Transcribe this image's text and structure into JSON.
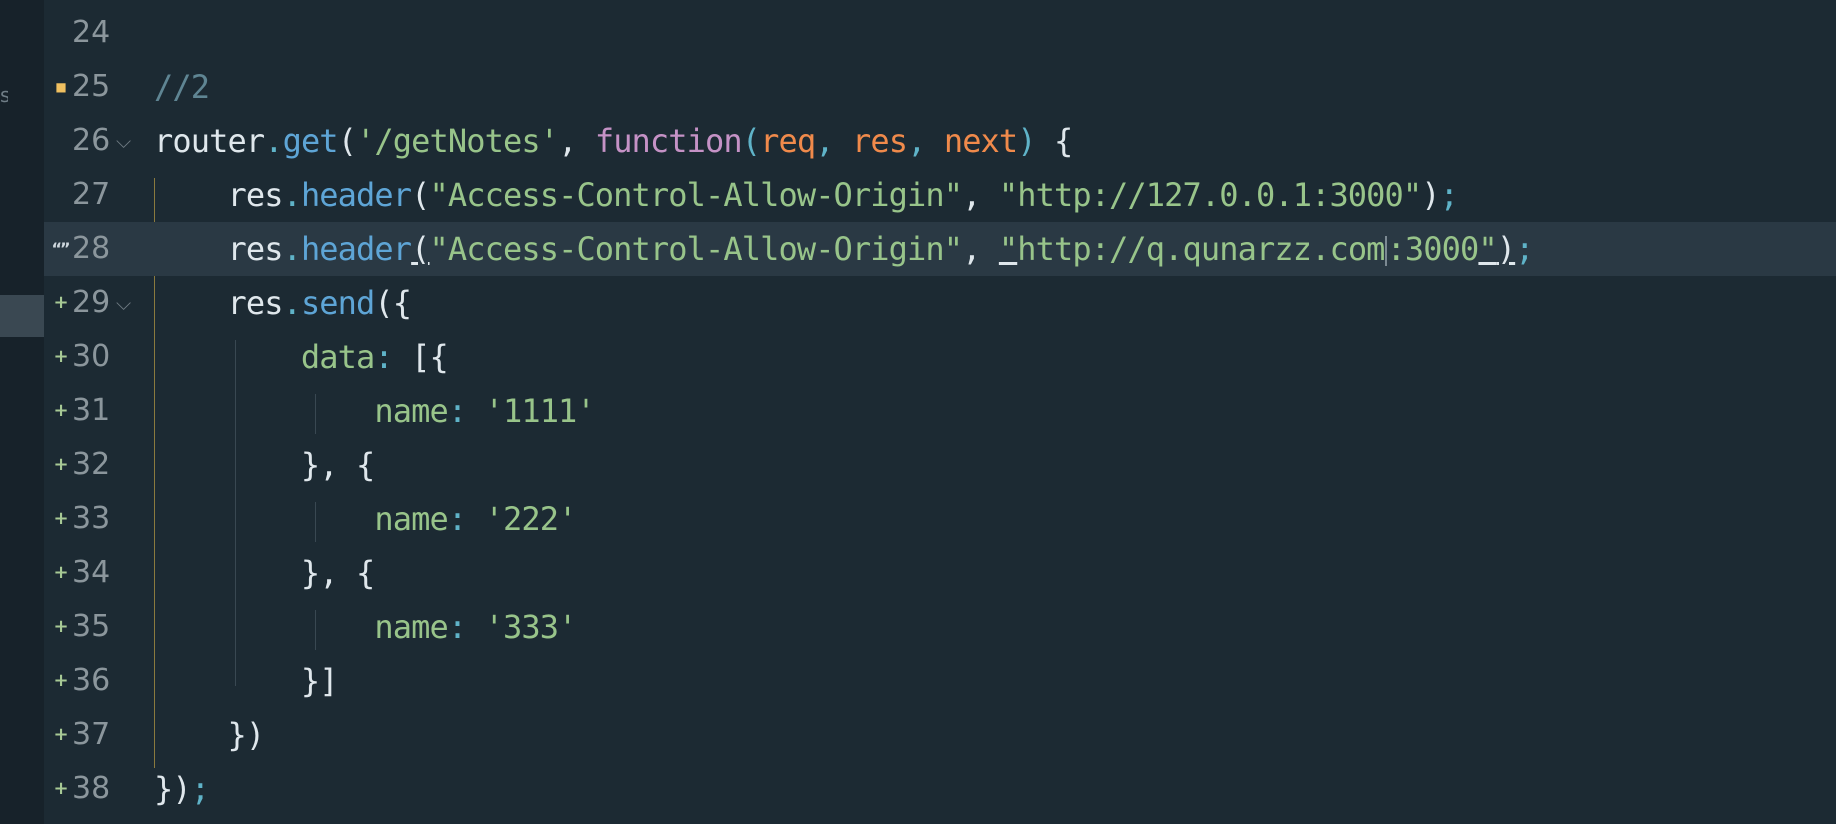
{
  "sidebar": {
    "fragment": "s"
  },
  "lines": [
    {
      "num": "24",
      "marker": "",
      "fold": false,
      "tokens": []
    },
    {
      "num": "25",
      "marker": "modified",
      "fold": false,
      "tokens": [
        {
          "t": "//2",
          "c": "comment"
        }
      ]
    },
    {
      "num": "26",
      "marker": "",
      "fold": true,
      "tokens": [
        {
          "t": "router",
          "c": "plain"
        },
        {
          "t": ".",
          "c": "punct"
        },
        {
          "t": "get",
          "c": "method"
        },
        {
          "t": "(",
          "c": "plain"
        },
        {
          "t": "'/getNotes'",
          "c": "string"
        },
        {
          "t": ", ",
          "c": "plain"
        },
        {
          "t": "function",
          "c": "keyword"
        },
        {
          "t": "(",
          "c": "punct"
        },
        {
          "t": "req",
          "c": "param"
        },
        {
          "t": ", ",
          "c": "punct"
        },
        {
          "t": "res",
          "c": "param"
        },
        {
          "t": ", ",
          "c": "punct"
        },
        {
          "t": "next",
          "c": "param"
        },
        {
          "t": ") ",
          "c": "punct"
        },
        {
          "t": "{",
          "c": "plain"
        }
      ]
    },
    {
      "num": "27",
      "marker": "",
      "fold": false,
      "tokens": [
        {
          "t": "    res",
          "c": "plain"
        },
        {
          "t": ".",
          "c": "punct"
        },
        {
          "t": "header",
          "c": "method"
        },
        {
          "t": "(",
          "c": "plain"
        },
        {
          "t": "\"Access-Control-Allow-Origin\"",
          "c": "string"
        },
        {
          "t": ", ",
          "c": "plain"
        },
        {
          "t": "\"http://127.0.0.1:3000\"",
          "c": "string"
        },
        {
          "t": ")",
          "c": "plain"
        },
        {
          "t": ";",
          "c": "punct"
        }
      ]
    },
    {
      "num": "28",
      "marker": "quote",
      "fold": false,
      "active": true,
      "tokens": [
        {
          "t": "    res",
          "c": "plain"
        },
        {
          "t": ".",
          "c": "punct"
        },
        {
          "t": "header",
          "c": "method"
        },
        {
          "t": "(",
          "c": "plain",
          "u": true
        },
        {
          "t": "\"Access-Control-Allow-Origin\"",
          "c": "string"
        },
        {
          "t": ", ",
          "c": "plain"
        },
        {
          "t": "\"",
          "c": "string",
          "u": true
        },
        {
          "t": "http://q.qunarzz.com",
          "c": "string"
        },
        {
          "t": "",
          "c": "cursor"
        },
        {
          "t": ":3000",
          "c": "string"
        },
        {
          "t": "\"",
          "c": "string",
          "u": true
        },
        {
          "t": ")",
          "c": "plain",
          "u": true
        },
        {
          "t": ";",
          "c": "punct"
        }
      ]
    },
    {
      "num": "29",
      "marker": "added",
      "fold": true,
      "tokens": [
        {
          "t": "    res",
          "c": "plain"
        },
        {
          "t": ".",
          "c": "punct"
        },
        {
          "t": "send",
          "c": "method"
        },
        {
          "t": "({",
          "c": "plain"
        }
      ]
    },
    {
      "num": "30",
      "marker": "added",
      "fold": false,
      "tokens": [
        {
          "t": "        data",
          "c": "prop"
        },
        {
          "t": ": ",
          "c": "punct"
        },
        {
          "t": "[{",
          "c": "plain"
        }
      ]
    },
    {
      "num": "31",
      "marker": "added",
      "fold": false,
      "tokens": [
        {
          "t": "            name",
          "c": "prop"
        },
        {
          "t": ": ",
          "c": "punct"
        },
        {
          "t": "'1111'",
          "c": "string"
        }
      ]
    },
    {
      "num": "32",
      "marker": "added",
      "fold": false,
      "tokens": [
        {
          "t": "        }, {",
          "c": "plain"
        }
      ]
    },
    {
      "num": "33",
      "marker": "added",
      "fold": false,
      "tokens": [
        {
          "t": "            name",
          "c": "prop"
        },
        {
          "t": ": ",
          "c": "punct"
        },
        {
          "t": "'222'",
          "c": "string"
        }
      ]
    },
    {
      "num": "34",
      "marker": "added",
      "fold": false,
      "tokens": [
        {
          "t": "        }, {",
          "c": "plain"
        }
      ]
    },
    {
      "num": "35",
      "marker": "added",
      "fold": false,
      "tokens": [
        {
          "t": "            name",
          "c": "prop"
        },
        {
          "t": ": ",
          "c": "punct"
        },
        {
          "t": "'333'",
          "c": "string"
        }
      ]
    },
    {
      "num": "36",
      "marker": "added",
      "fold": false,
      "tokens": [
        {
          "t": "        }]",
          "c": "plain"
        }
      ]
    },
    {
      "num": "37",
      "marker": "added",
      "fold": false,
      "tokens": [
        {
          "t": "    })",
          "c": "plain"
        }
      ]
    },
    {
      "num": "38",
      "marker": "added",
      "fold": false,
      "tokens": [
        {
          "t": "})",
          "c": "plain"
        },
        {
          "t": ";",
          "c": "punct"
        }
      ]
    }
  ],
  "markers": {
    "added": "+",
    "modified": "■",
    "quote": "“”"
  },
  "fold_glyph": "⌵"
}
